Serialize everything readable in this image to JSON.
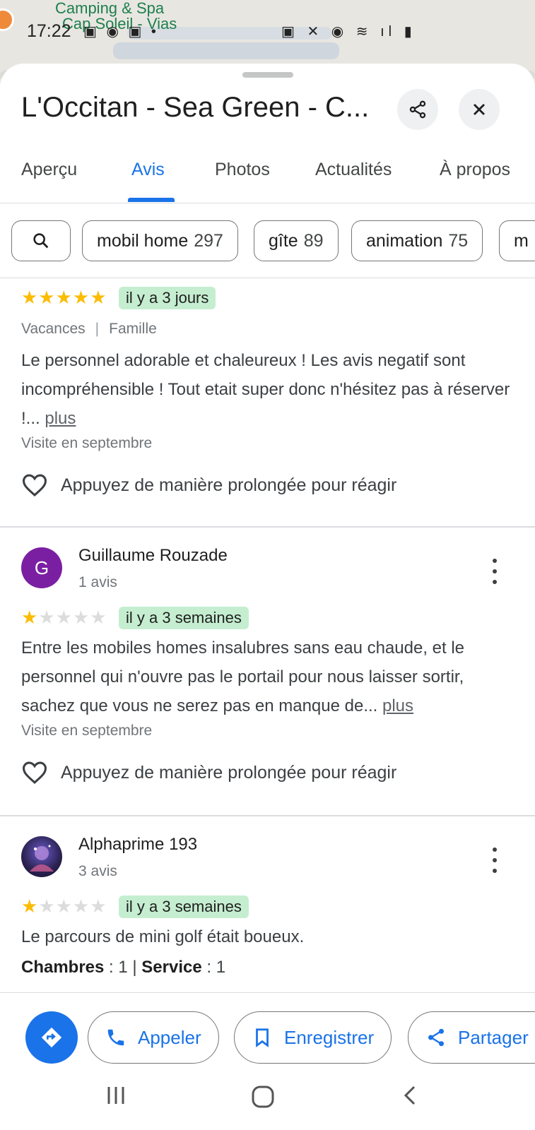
{
  "status_bar": {
    "time": "17:22",
    "left_icons": "▣ ◉ ▣ •",
    "right_icons": "▣ ✕ ◉ ≋ ıl ▮"
  },
  "map": {
    "label_line1": "Camping & Spa",
    "label_line2": "Cap Soleil - Vias"
  },
  "place": {
    "title": "L'Occitan - Sea Green - C..."
  },
  "tabs": [
    {
      "label": "Aperçu"
    },
    {
      "label": "Avis"
    },
    {
      "label": "Photos"
    },
    {
      "label": "Actualités"
    },
    {
      "label": "À propos"
    }
  ],
  "active_tab": "Avis",
  "chips": [
    {
      "label": "mobil home",
      "count": "297"
    },
    {
      "label": "gîte",
      "count": "89"
    },
    {
      "label": "animation",
      "count": "75"
    },
    {
      "label": "m",
      "count": ""
    }
  ],
  "reviews": [
    {
      "rating": 5,
      "stars_on": "★★★★★",
      "stars_off": "",
      "when": "il y a 3 jours",
      "trip_type": "Vacances",
      "companions": "Famille",
      "text": "Le personnel adorable et chaleureux ! Les avis negatif sont incompréhensible ! Tout etait super donc n'hésitez pas à réserver !... ",
      "more": "plus",
      "visit": "Visite en septembre",
      "react": "Appuyez de manière prolongée pour réagir"
    },
    {
      "author": "Guillaume Rouzade",
      "avatar_letter": "G",
      "author_sub": "1 avis",
      "rating": 1,
      "stars_on": "★",
      "stars_off": "★★★★",
      "when": "il y a 3 semaines",
      "text": "Entre les mobiles homes insalubres sans eau chaude, et le personnel qui n'ouvre pas le portail pour nous laisser sortir, sachez que vous ne serez pas en manque de... ",
      "more": "plus",
      "visit": "Visite en septembre",
      "react": "Appuyez de manière prolongée pour réagir"
    },
    {
      "author": "Alphaprime 193",
      "author_sub": "3 avis",
      "rating": 1,
      "stars_on": "★",
      "stars_off": "★★★★",
      "when": "il y a 3 semaines",
      "text": "Le parcours de mini golf était boueux.",
      "ratings_line": {
        "label1": "Chambres",
        "value1": " : 1 | ",
        "label2": "Service",
        "value2": " : 1"
      }
    }
  ],
  "actions": {
    "call": "Appeler",
    "save": "Enregistrer",
    "share": "Partager"
  },
  "colors": {
    "accent": "#1a73e8",
    "star": "#fbbc04",
    "badge_bg": "#c5eed0",
    "avatar_g": "#7b1fa2"
  }
}
